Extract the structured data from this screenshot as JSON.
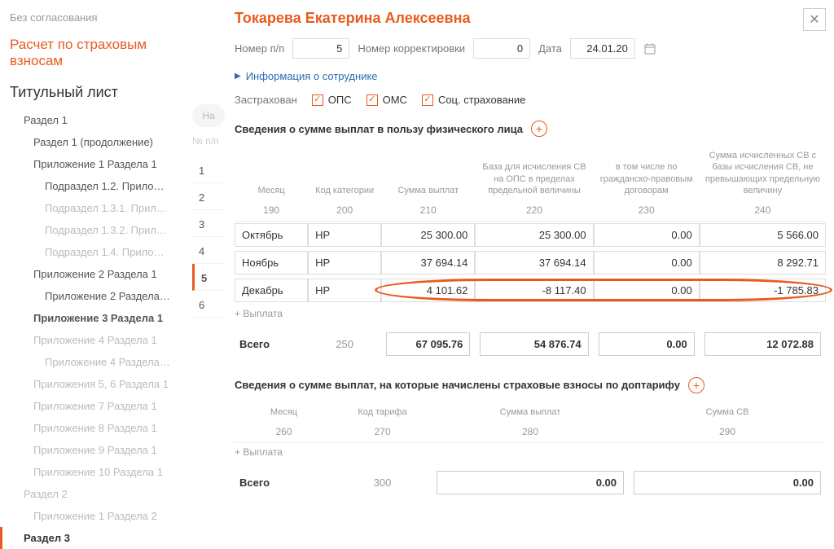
{
  "sidebar": {
    "status": "Без согласования",
    "mainTitle": "Расчет по страховым взносам",
    "subTitle": "Титульный лист",
    "tree": [
      {
        "label": "Раздел 1",
        "lvl": 1,
        "dim": false
      },
      {
        "label": "Раздел 1 (продолжение)",
        "lvl": 2,
        "dim": false
      },
      {
        "label": "Приложение 1 Раздела 1",
        "lvl": 2,
        "dim": false
      },
      {
        "label": "Подраздел 1.2. Прило…",
        "lvl": 3,
        "dim": false
      },
      {
        "label": "Подраздел 1.3.1. Прил…",
        "lvl": 3,
        "dim": true
      },
      {
        "label": "Подраздел 1.3.2. Прил…",
        "lvl": 3,
        "dim": true
      },
      {
        "label": "Подраздел 1.4. Прило…",
        "lvl": 3,
        "dim": true
      },
      {
        "label": "Приложение 2 Раздела 1",
        "lvl": 2,
        "dim": false
      },
      {
        "label": "Приложение 2 Раздела…",
        "lvl": 3,
        "dim": false
      },
      {
        "label": "Приложение 3 Раздела 1",
        "lvl": 2,
        "dim": false,
        "bold": true
      },
      {
        "label": "Приложение 4 Раздела 1",
        "lvl": 2,
        "dim": true
      },
      {
        "label": "Приложение 4 Раздела…",
        "lvl": 3,
        "dim": true
      },
      {
        "label": "Приложения 5, 6 Раздела 1",
        "lvl": 2,
        "dim": true
      },
      {
        "label": "Приложение 7 Раздела 1",
        "lvl": 2,
        "dim": true
      },
      {
        "label": "Приложение 8 Раздела 1",
        "lvl": 2,
        "dim": true
      },
      {
        "label": "Приложение 9 Раздела 1",
        "lvl": 2,
        "dim": true
      },
      {
        "label": "Приложение 10 Раздела 1",
        "lvl": 2,
        "dim": true
      },
      {
        "label": "Раздел 2",
        "lvl": 1,
        "dim": true
      },
      {
        "label": "Приложение 1 Раздела 2",
        "lvl": 2,
        "dim": true
      },
      {
        "label": "Раздел 3",
        "lvl": 1,
        "dim": false,
        "active": true
      }
    ]
  },
  "midStrip": {
    "btn": "На",
    "head": "№ п/п",
    "nums": [
      "1",
      "2",
      "3",
      "4",
      "5",
      "6"
    ],
    "activeIndex": 4
  },
  "main": {
    "employee": "Токарева Екатерина Алексеевна",
    "fields": {
      "numLabel": "Номер п/п",
      "numValue": "5",
      "corrLabel": "Номер корректировки",
      "corrValue": "0",
      "dateLabel": "Дата",
      "dateValue": "24.01.20"
    },
    "expandLabel": "Информация о сотруднике",
    "insured": {
      "label": "Застрахован",
      "ops": "ОПС",
      "oms": "ОМС",
      "soc": "Соц. страхование"
    },
    "section1": {
      "title": "Сведения о сумме выплат в пользу физического лица",
      "headers": [
        "Месяц",
        "Код категории",
        "Сумма выплат",
        "База для исчисления СВ на ОПС в пределах предельной величины",
        "в том числе по гражданско-правовым договорам",
        "Сумма исчисленных СВ с базы исчисления СВ, не превышающих предельную величину"
      ],
      "codes": [
        "190",
        "200",
        "210",
        "220",
        "230",
        "240"
      ],
      "rows": [
        {
          "month": "Октябрь",
          "code": "НР",
          "sum": "25 300.00",
          "base": "25 300.00",
          "gpd": "0.00",
          "sv": "5 566.00"
        },
        {
          "month": "Ноябрь",
          "code": "НР",
          "sum": "37 694.14",
          "base": "37 694.14",
          "gpd": "0.00",
          "sv": "8 292.71"
        },
        {
          "month": "Декабрь",
          "code": "НР",
          "sum": "4 101.62",
          "base": "-8 117.40",
          "gpd": "0.00",
          "sv": "-1 785.83"
        }
      ],
      "addLabel": "+ Выплата",
      "total": {
        "label": "Всего",
        "code": "250",
        "sum": "67 095.76",
        "base": "54 876.74",
        "gpd": "0.00",
        "sv": "12 072.88"
      }
    },
    "section2": {
      "title": "Сведения о сумме выплат, на которые начислены страховые взносы по доптарифу",
      "headers": [
        "Месяц",
        "Код тарифа",
        "Сумма выплат",
        "Сумма СВ"
      ],
      "codes": [
        "260",
        "270",
        "280",
        "290"
      ],
      "addLabel": "+ Выплата",
      "total": {
        "label": "Всего",
        "code": "300",
        "sum": "0.00",
        "sv": "0.00"
      }
    }
  }
}
